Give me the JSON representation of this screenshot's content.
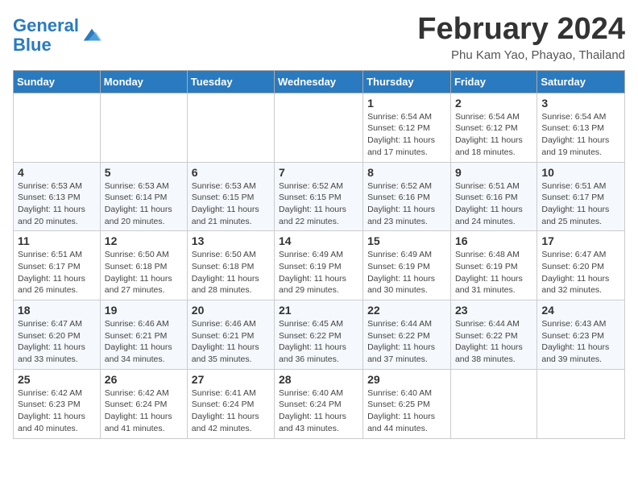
{
  "logo": {
    "line1": "General",
    "line2": "Blue"
  },
  "title": "February 2024",
  "subtitle": "Phu Kam Yao, Phayao, Thailand",
  "days_of_week": [
    "Sunday",
    "Monday",
    "Tuesday",
    "Wednesday",
    "Thursday",
    "Friday",
    "Saturday"
  ],
  "weeks": [
    [
      {
        "day": "",
        "info": ""
      },
      {
        "day": "",
        "info": ""
      },
      {
        "day": "",
        "info": ""
      },
      {
        "day": "",
        "info": ""
      },
      {
        "day": "1",
        "info": "Sunrise: 6:54 AM\nSunset: 6:12 PM\nDaylight: 11 hours and 17 minutes."
      },
      {
        "day": "2",
        "info": "Sunrise: 6:54 AM\nSunset: 6:12 PM\nDaylight: 11 hours and 18 minutes."
      },
      {
        "day": "3",
        "info": "Sunrise: 6:54 AM\nSunset: 6:13 PM\nDaylight: 11 hours and 19 minutes."
      }
    ],
    [
      {
        "day": "4",
        "info": "Sunrise: 6:53 AM\nSunset: 6:13 PM\nDaylight: 11 hours and 20 minutes."
      },
      {
        "day": "5",
        "info": "Sunrise: 6:53 AM\nSunset: 6:14 PM\nDaylight: 11 hours and 20 minutes."
      },
      {
        "day": "6",
        "info": "Sunrise: 6:53 AM\nSunset: 6:15 PM\nDaylight: 11 hours and 21 minutes."
      },
      {
        "day": "7",
        "info": "Sunrise: 6:52 AM\nSunset: 6:15 PM\nDaylight: 11 hours and 22 minutes."
      },
      {
        "day": "8",
        "info": "Sunrise: 6:52 AM\nSunset: 6:16 PM\nDaylight: 11 hours and 23 minutes."
      },
      {
        "day": "9",
        "info": "Sunrise: 6:51 AM\nSunset: 6:16 PM\nDaylight: 11 hours and 24 minutes."
      },
      {
        "day": "10",
        "info": "Sunrise: 6:51 AM\nSunset: 6:17 PM\nDaylight: 11 hours and 25 minutes."
      }
    ],
    [
      {
        "day": "11",
        "info": "Sunrise: 6:51 AM\nSunset: 6:17 PM\nDaylight: 11 hours and 26 minutes."
      },
      {
        "day": "12",
        "info": "Sunrise: 6:50 AM\nSunset: 6:18 PM\nDaylight: 11 hours and 27 minutes."
      },
      {
        "day": "13",
        "info": "Sunrise: 6:50 AM\nSunset: 6:18 PM\nDaylight: 11 hours and 28 minutes."
      },
      {
        "day": "14",
        "info": "Sunrise: 6:49 AM\nSunset: 6:19 PM\nDaylight: 11 hours and 29 minutes."
      },
      {
        "day": "15",
        "info": "Sunrise: 6:49 AM\nSunset: 6:19 PM\nDaylight: 11 hours and 30 minutes."
      },
      {
        "day": "16",
        "info": "Sunrise: 6:48 AM\nSunset: 6:19 PM\nDaylight: 11 hours and 31 minutes."
      },
      {
        "day": "17",
        "info": "Sunrise: 6:47 AM\nSunset: 6:20 PM\nDaylight: 11 hours and 32 minutes."
      }
    ],
    [
      {
        "day": "18",
        "info": "Sunrise: 6:47 AM\nSunset: 6:20 PM\nDaylight: 11 hours and 33 minutes."
      },
      {
        "day": "19",
        "info": "Sunrise: 6:46 AM\nSunset: 6:21 PM\nDaylight: 11 hours and 34 minutes."
      },
      {
        "day": "20",
        "info": "Sunrise: 6:46 AM\nSunset: 6:21 PM\nDaylight: 11 hours and 35 minutes."
      },
      {
        "day": "21",
        "info": "Sunrise: 6:45 AM\nSunset: 6:22 PM\nDaylight: 11 hours and 36 minutes."
      },
      {
        "day": "22",
        "info": "Sunrise: 6:44 AM\nSunset: 6:22 PM\nDaylight: 11 hours and 37 minutes."
      },
      {
        "day": "23",
        "info": "Sunrise: 6:44 AM\nSunset: 6:22 PM\nDaylight: 11 hours and 38 minutes."
      },
      {
        "day": "24",
        "info": "Sunrise: 6:43 AM\nSunset: 6:23 PM\nDaylight: 11 hours and 39 minutes."
      }
    ],
    [
      {
        "day": "25",
        "info": "Sunrise: 6:42 AM\nSunset: 6:23 PM\nDaylight: 11 hours and 40 minutes."
      },
      {
        "day": "26",
        "info": "Sunrise: 6:42 AM\nSunset: 6:24 PM\nDaylight: 11 hours and 41 minutes."
      },
      {
        "day": "27",
        "info": "Sunrise: 6:41 AM\nSunset: 6:24 PM\nDaylight: 11 hours and 42 minutes."
      },
      {
        "day": "28",
        "info": "Sunrise: 6:40 AM\nSunset: 6:24 PM\nDaylight: 11 hours and 43 minutes."
      },
      {
        "day": "29",
        "info": "Sunrise: 6:40 AM\nSunset: 6:25 PM\nDaylight: 11 hours and 44 minutes."
      },
      {
        "day": "",
        "info": ""
      },
      {
        "day": "",
        "info": ""
      }
    ]
  ]
}
